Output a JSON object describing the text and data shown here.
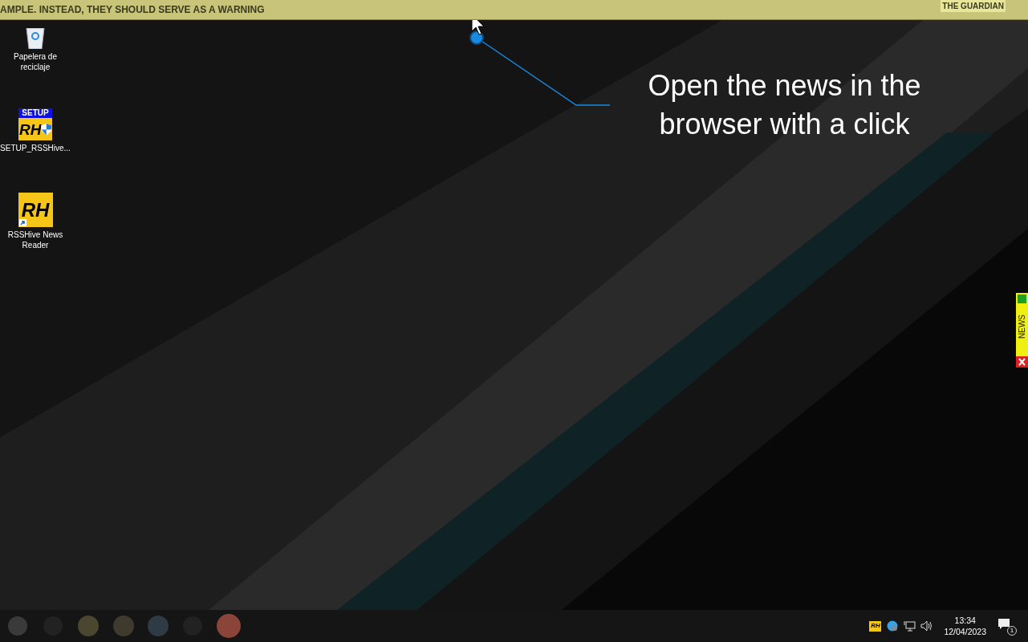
{
  "ticker": {
    "headline": "AMPLE. INSTEAD, THEY SHOULD SERVE AS A WARNING",
    "source": "THE GUARDIAN"
  },
  "desktop_icons": [
    {
      "kind": "recycle",
      "label": "Papelera de reciclaje"
    },
    {
      "kind": "setup",
      "badge": "SETUP",
      "logo": "RH",
      "label": "SETUP_RSSHive..."
    },
    {
      "kind": "app",
      "logo": "RH",
      "label": "RSSHive News Reader"
    }
  ],
  "callout": {
    "text": "Open the news in the browser with a click"
  },
  "side_tab": {
    "label": "NEWS"
  },
  "taskbar": {
    "tray_logo": "RH",
    "time": "13:34",
    "date": "12/04/2023",
    "notification_count": "1"
  }
}
